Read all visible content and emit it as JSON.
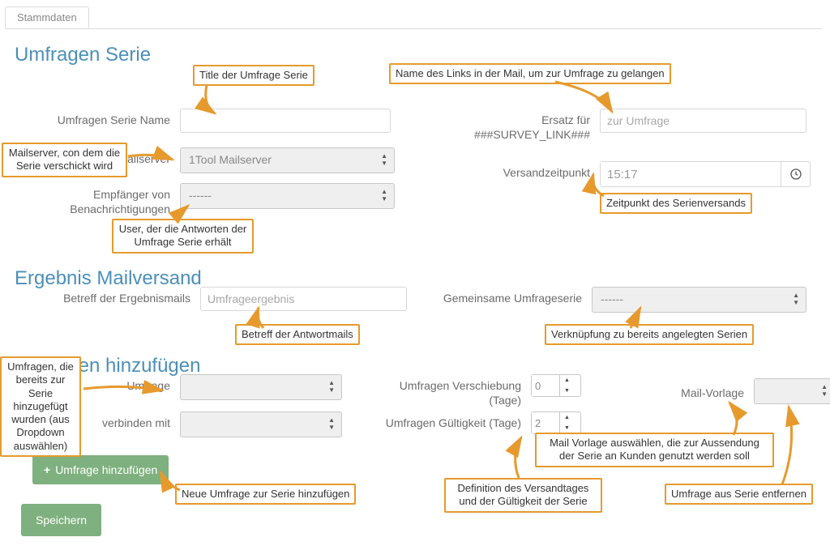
{
  "tab": {
    "stammdaten": "Stammdaten"
  },
  "sections": {
    "serie": "Umfragen Serie",
    "ergebnis": "Ergebnis Mailversand",
    "hinzufuegen": "Umfragen hinzufügen"
  },
  "labels": {
    "serie_name": "Umfragen Serie Name",
    "mailserver": "Mailserver",
    "empfaenger": "Empfänger von Benachrichtigungen",
    "ersatz": "Ersatz für ###SURVEY_LINK###",
    "versandzeitpunkt": "Versandzeitpunkt",
    "betreff": "Betreff der Ergebnismails",
    "gemeinsame": "Gemeinsame Umfrageserie",
    "umfrage": "Umfrage",
    "verbinden": "verbinden mit",
    "verschiebung": "Umfragen Verschiebung (Tage)",
    "gueltigkeit": "Umfragen Gültigkeit (Tage)",
    "mailvorlage": "Mail-Vorlage"
  },
  "values": {
    "mailserver": "1Tool Mailserver",
    "empfaenger": "------",
    "ersatz_placeholder": "zur Umfrage",
    "versandzeitpunkt": "15:17",
    "betreff_placeholder": "Umfrageergebnis",
    "gemeinsame": "------",
    "verschiebung": "0",
    "gueltigkeit": "2"
  },
  "buttons": {
    "add": "Umfrage hinzufügen",
    "save": "Speichern"
  },
  "callouts": {
    "c1": "Title der Umfrage Serie",
    "c2": "Name des Links in der Mail, um zur Umfrage zu gelangen",
    "c3": "Mailserver, con dem die Serie verschickt wird",
    "c4": "Zeitpunkt des Serienversands",
    "c5": "User, der die Antworten der Umfrage Serie erhält",
    "c6": "Betreff der Antwortmails",
    "c7": "Verknüpfung zu bereits angelegten Serien",
    "c8": "Umfragen, die bereits zur Serie hinzugefügt wurden (aus Dropdown auswählen)",
    "c9": "Neue Umfrage zur Serie hinzufügen",
    "c10": "Definition des Versandtages und der Gültigkeit der Serie",
    "c11": "Mail Vorlage auswählen, die zur Aussendung der Serie an Kunden genutzt werden soll",
    "c12": "Umfrage aus Serie entfernen"
  }
}
